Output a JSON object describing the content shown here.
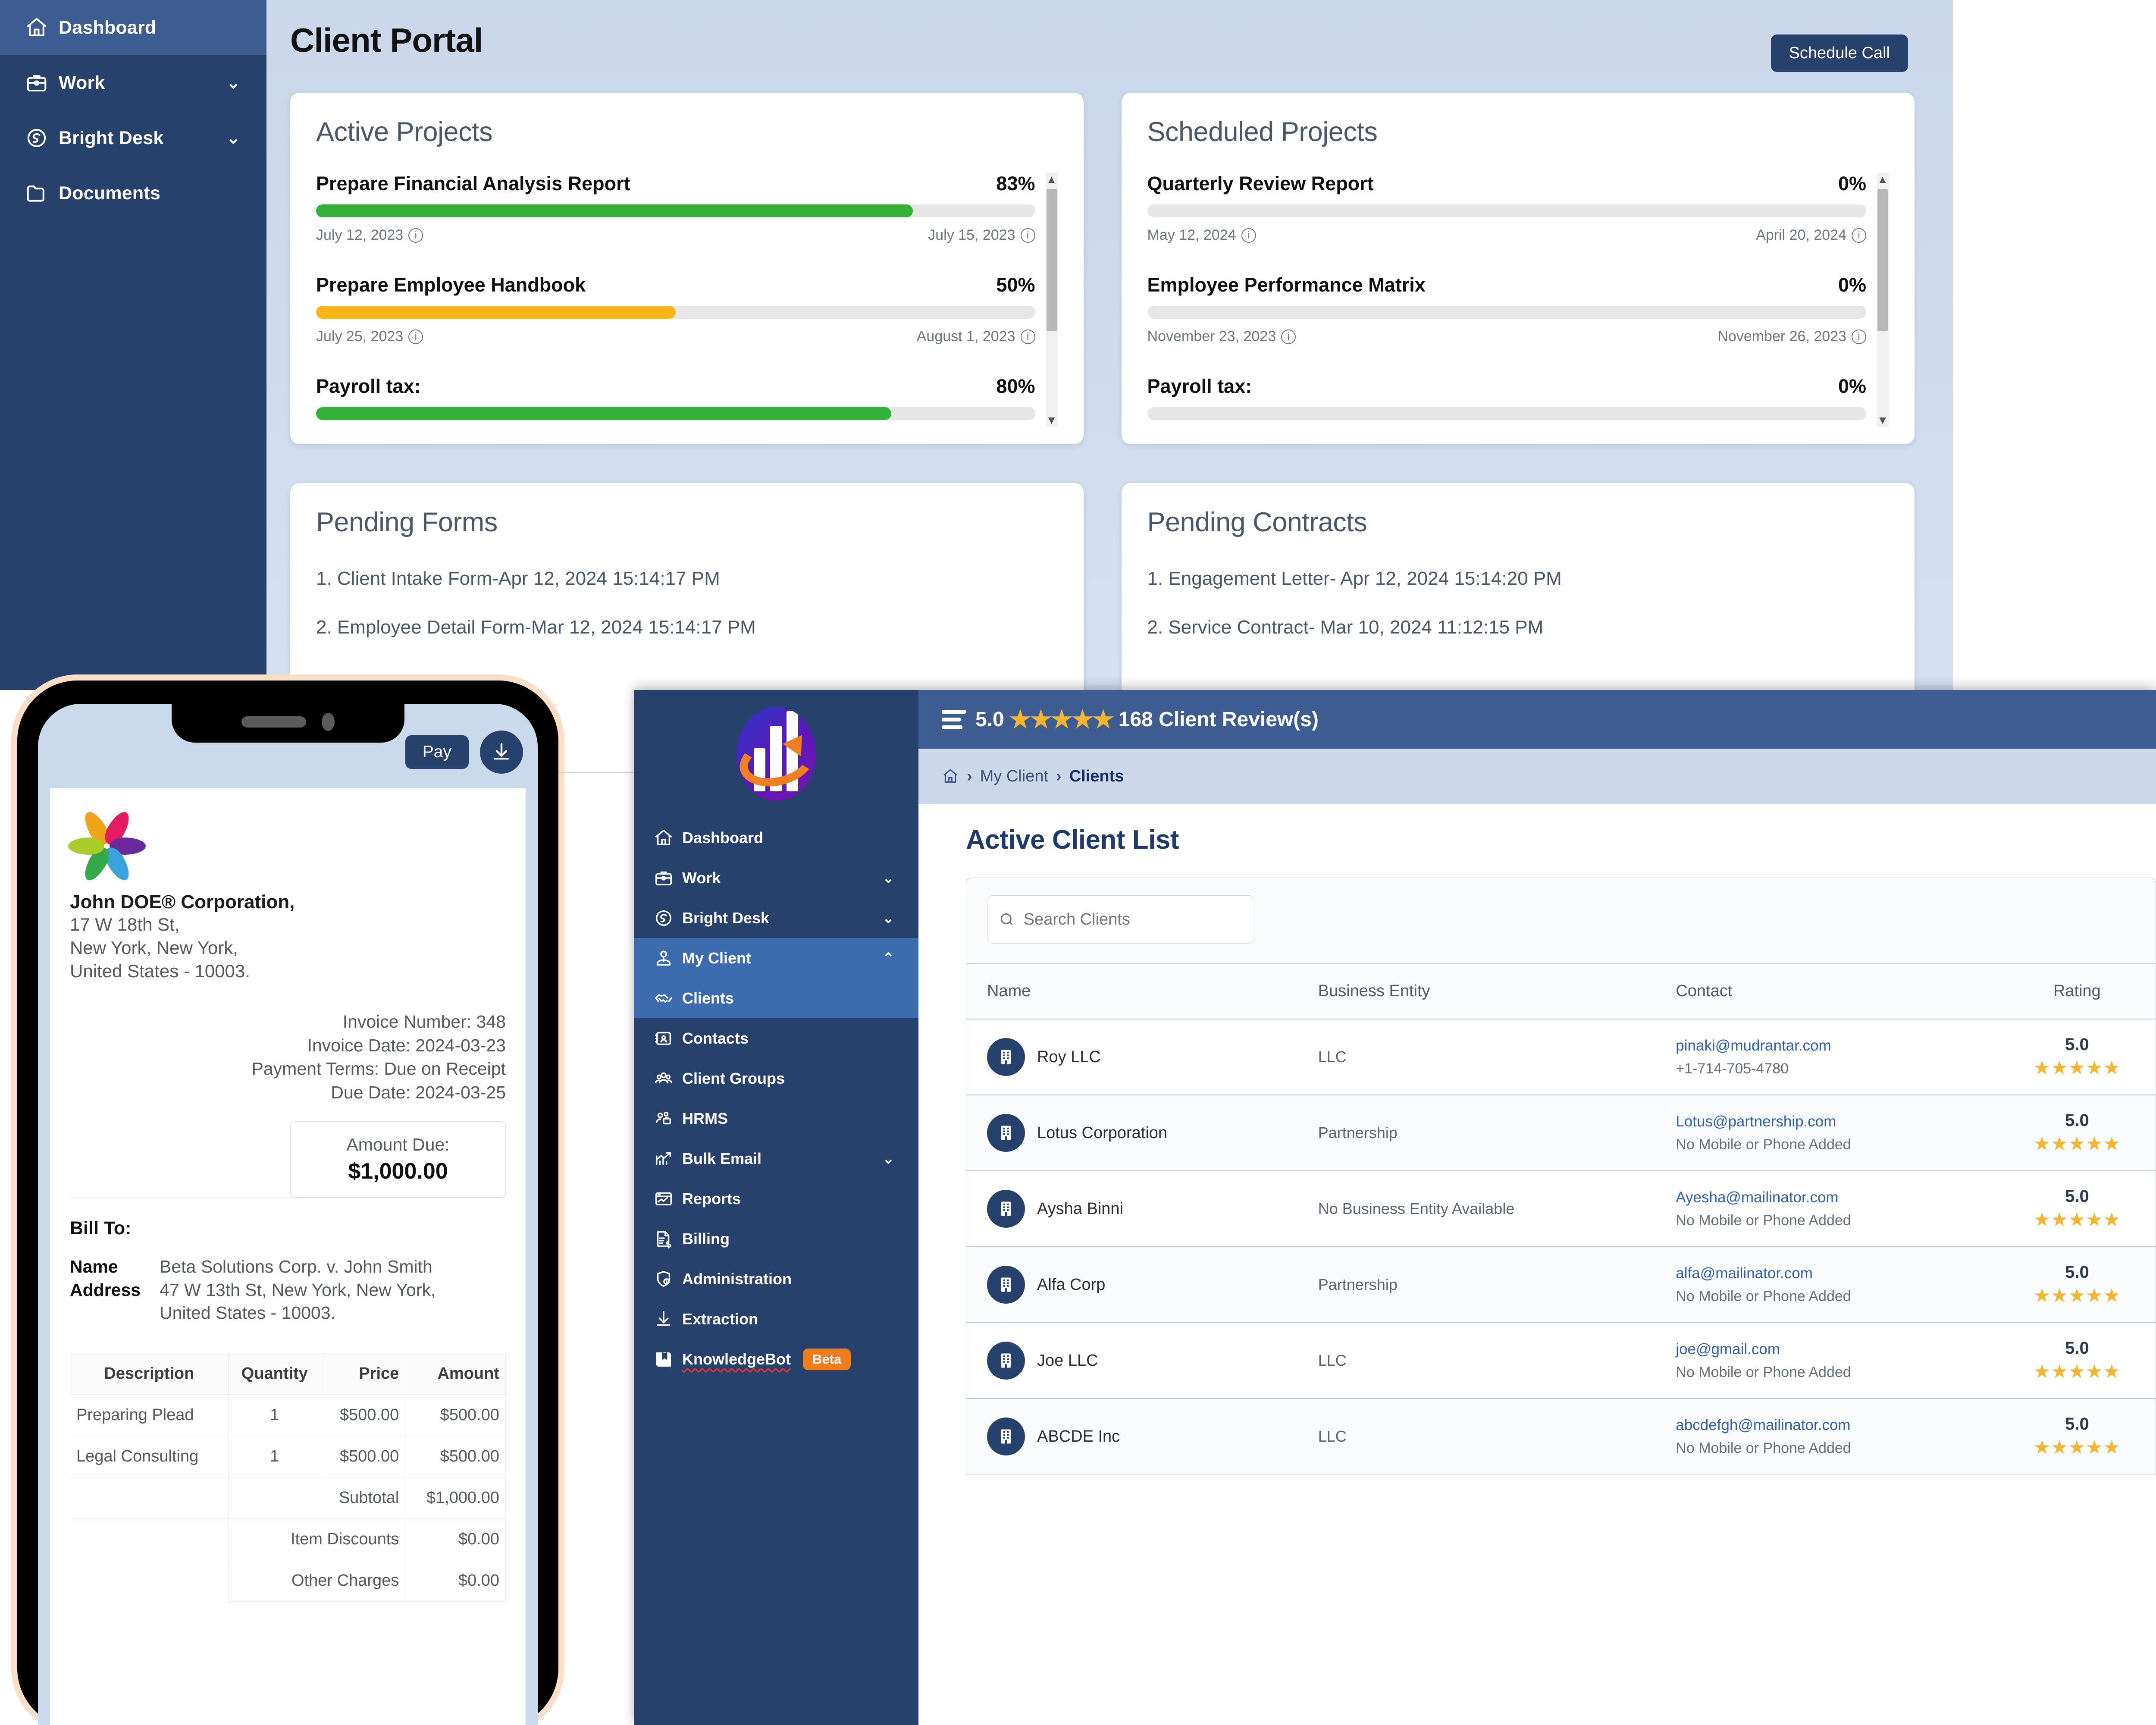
{
  "portal": {
    "title": "Client Portal",
    "schedule_call_label": "Schedule Call",
    "sidebar": {
      "items": [
        {
          "label": "Dashboard",
          "icon": "home-icon",
          "chevron": "",
          "active": true
        },
        {
          "label": "Work",
          "icon": "briefcase-icon",
          "chevron": "⌄",
          "active": false
        },
        {
          "label": "Bright Desk",
          "icon": "headset-icon",
          "chevron": "⌄",
          "active": false
        },
        {
          "label": "Documents",
          "icon": "folder-icon",
          "chevron": "",
          "active": false
        }
      ]
    },
    "active_projects": {
      "heading": "Active Projects",
      "rows": [
        {
          "name": "Prepare Financial Analysis Report",
          "percent": "83%",
          "value": 83,
          "color": "#33b139",
          "start": "July 12, 2023",
          "end": "July 15, 2023"
        },
        {
          "name": "Prepare Employee Handbook",
          "percent": "50%",
          "value": 50,
          "color": "#f7b519",
          "start": "July 25, 2023",
          "end": "August 1, 2023"
        },
        {
          "name": "Payroll tax:",
          "percent": "80%",
          "value": 80,
          "color": "#33b139",
          "start": "",
          "end": ""
        }
      ]
    },
    "scheduled_projects": {
      "heading": "Scheduled Projects",
      "rows": [
        {
          "name": "Quarterly Review Report",
          "percent": "0%",
          "value": 0,
          "color": "#e7e7e7",
          "start": "May 12, 2024",
          "end": "April 20, 2024"
        },
        {
          "name": "Employee Performance Matrix",
          "percent": "0%",
          "value": 0,
          "color": "#e7e7e7",
          "start": "November 23, 2023",
          "end": "November 26, 2023"
        },
        {
          "name": "Payroll tax:",
          "percent": "0%",
          "value": 0,
          "color": "#e7e7e7",
          "start": "",
          "end": ""
        }
      ]
    },
    "pending_forms": {
      "heading": "Pending Forms",
      "items": [
        "1. Client Intake Form-Apr 12, 2024 15:14:17 PM",
        "2. Employee Detail Form-Mar 12, 2024 15:14:17 PM"
      ]
    },
    "pending_contracts": {
      "heading": "Pending Contracts",
      "items": [
        "1. Engagement Letter- Apr 12, 2024 15:14:20 PM",
        "2. Service Contract- Mar 10, 2024 11:12:15 PM"
      ]
    }
  },
  "phone": {
    "pay_label": "Pay",
    "download_icon": "download-icon",
    "invoice": {
      "company_name": "John DOE® Corporation,",
      "company_address_line1": "17 W 18th St,",
      "company_address_line2": "New York, New York,",
      "company_address_line3": "United States - 10003.",
      "meta": [
        "Invoice Number: 348",
        "Invoice Date: 2024-03-23",
        "Payment Terms: Due on Receipt",
        "Due Date: 2024-03-25"
      ],
      "amount_due_label": "Amount Due:",
      "amount_due_value": "$1,000.00",
      "bill_to_label": "Bill To:",
      "name_key": "Name",
      "name_value": "Beta Solutions Corp. v. John Smith",
      "address_key": "Address",
      "address_value_line1": "47 W 13th St, New York, New York,",
      "address_value_line2": "United States - 10003.",
      "table_headers": [
        "Description",
        "Quantity",
        "Price",
        "Amount"
      ],
      "line_items": [
        {
          "description": "Preparing Plead",
          "quantity": "1",
          "price": "$500.00",
          "amount": "$500.00"
        },
        {
          "description": "Legal Consulting",
          "quantity": "1",
          "price": "$500.00",
          "amount": "$500.00"
        }
      ],
      "summary": [
        {
          "label": "Subtotal",
          "value": "$1,000.00"
        },
        {
          "label": "Item Discounts",
          "value": "$0.00"
        },
        {
          "label": "Other Charges",
          "value": "$0.00"
        }
      ]
    }
  },
  "app": {
    "logo_icon": "mudrantar-bar-chart-logo",
    "menu_icon": "hamburger-icon",
    "rating_value": "5.0",
    "rating_stars": "★★★★★",
    "reviews_label": "168 Client Review(s)",
    "breadcrumb": {
      "home_icon": "home-icon",
      "sep": "›",
      "level1": "My Client",
      "level2": "Clients"
    },
    "sidebar": {
      "items": [
        {
          "label": "Dashboard",
          "icon": "home-icon",
          "chevron": "",
          "state": "normal"
        },
        {
          "label": "Work",
          "icon": "briefcase-icon",
          "chevron": "⌄",
          "state": "normal"
        },
        {
          "label": "Bright Desk",
          "icon": "headset-icon",
          "chevron": "⌄",
          "state": "normal"
        },
        {
          "label": "My Client",
          "icon": "user-tie-icon",
          "chevron": "⌃",
          "state": "sel"
        },
        {
          "label": "Clients",
          "icon": "handshake-icon",
          "chevron": "",
          "state": "sub"
        },
        {
          "label": "Contacts",
          "icon": "contact-card-icon",
          "chevron": "",
          "state": "normal"
        },
        {
          "label": "Client Groups",
          "icon": "users-group-icon",
          "chevron": "",
          "state": "normal"
        },
        {
          "label": "HRMS",
          "icon": "hrms-people-icon",
          "chevron": "",
          "state": "normal"
        },
        {
          "label": "Bulk Email",
          "icon": "growth-chart-icon",
          "chevron": "⌄",
          "state": "normal"
        },
        {
          "label": "Reports",
          "icon": "report-window-icon",
          "chevron": "",
          "state": "normal"
        },
        {
          "label": "Billing",
          "icon": "invoice-dollar-icon",
          "chevron": "",
          "state": "normal"
        },
        {
          "label": "Administration",
          "icon": "shield-user-icon",
          "chevron": "",
          "state": "normal"
        },
        {
          "label": "Extraction",
          "icon": "download-icon",
          "chevron": "",
          "state": "normal"
        },
        {
          "label": "KnowledgeBot",
          "icon": "book-icon",
          "chevron": "",
          "state": "normal",
          "badge": "Beta"
        }
      ]
    },
    "page_title": "Active Client List",
    "search_placeholder": "Search Clients",
    "search_value": "",
    "search_icon": "search-icon",
    "table": {
      "headers": [
        "Name",
        "Business Entity",
        "Contact",
        "Rating"
      ],
      "rows": [
        {
          "name": "Roy LLC",
          "entity": "LLC",
          "email": "pinaki@mudrantar.com",
          "phone": "+1-714-705-4780",
          "rating": "5.0",
          "stars": "★★★★★"
        },
        {
          "name": "Lotus Corporation",
          "entity": "Partnership",
          "email": "Lotus@partnership.com",
          "phone": "No Mobile or Phone Added",
          "rating": "5.0",
          "stars": "★★★★★"
        },
        {
          "name": "Aysha Binni",
          "entity": "No Business Entity Available",
          "email": "Ayesha@mailinator.com",
          "phone": "No Mobile or Phone Added",
          "rating": "5.0",
          "stars": "★★★★★"
        },
        {
          "name": "Alfa Corp",
          "entity": "Partnership",
          "email": "alfa@mailinator.com",
          "phone": "No Mobile or Phone Added",
          "rating": "5.0",
          "stars": "★★★★★"
        },
        {
          "name": "Joe LLC",
          "entity": "LLC",
          "email": "joe@gmail.com",
          "phone": "No Mobile or Phone Added",
          "rating": "5.0",
          "stars": "★★★★★"
        },
        {
          "name": "ABCDE Inc",
          "entity": "LLC",
          "email": "abcdefgh@mailinator.com",
          "phone": "No Mobile or Phone Added",
          "rating": "5.0",
          "stars": "★★★★★"
        }
      ]
    }
  },
  "colors": {
    "sidebar_navy": "#27416d",
    "sidebar_active": "#3d5c92",
    "accent_orange": "#f07d1b",
    "progress_green": "#33b139",
    "progress_amber": "#f7b519",
    "star_gold": "#f5b52e",
    "portal_bg": "#ccd8ea"
  }
}
